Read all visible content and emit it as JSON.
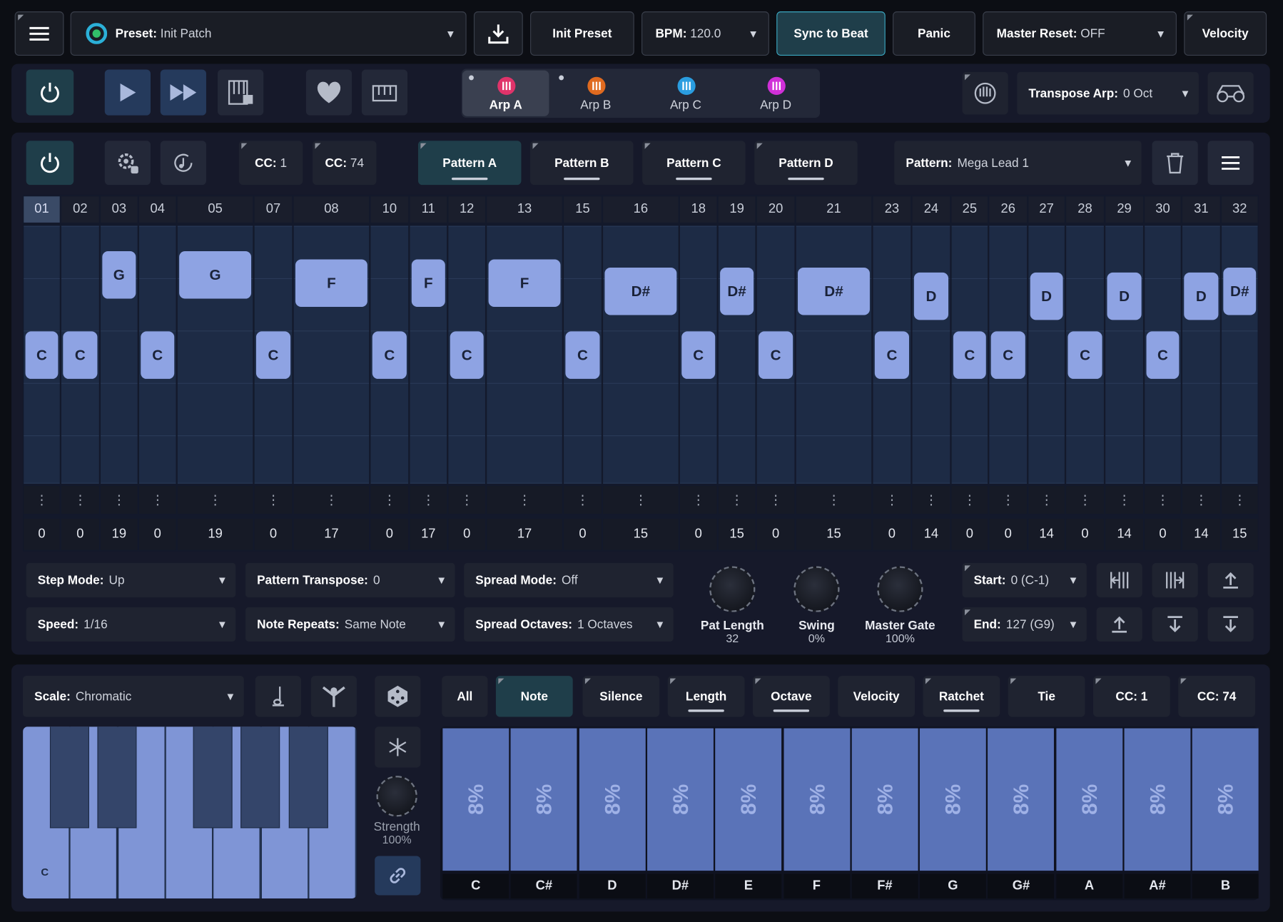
{
  "toolbar": {
    "preset_label": "Preset:",
    "preset_value": "Init Patch",
    "init_preset": "Init Preset",
    "bpm_label": "BPM:",
    "bpm_value": "120.0",
    "sync_to_beat": "Sync to Beat",
    "panic": "Panic",
    "master_reset_label": "Master Reset:",
    "master_reset_value": "OFF",
    "velocity": "Velocity"
  },
  "transport": {
    "arps": [
      {
        "label": "Arp A",
        "color": "#e0336a",
        "active": true
      },
      {
        "label": "Arp B",
        "color": "#e06a1f",
        "active": false
      },
      {
        "label": "Arp C",
        "color": "#2a9de0",
        "active": false
      },
      {
        "label": "Arp D",
        "color": "#d030d8",
        "active": false
      }
    ],
    "transpose_label": "Transpose Arp:",
    "transpose_value": "0 Oct"
  },
  "pattern_bar": {
    "cc1_label": "CC:",
    "cc1_value": "1",
    "cc2_label": "CC:",
    "cc2_value": "74",
    "patterns": [
      "Pattern A",
      "Pattern B",
      "Pattern C",
      "Pattern D"
    ],
    "pattern_label": "Pattern:",
    "pattern_value": "Mega Lead 1"
  },
  "steps": {
    "numbers": [
      "01",
      "02",
      "03",
      "04",
      "05",
      "07",
      "08",
      "10",
      "11",
      "12",
      "13",
      "15",
      "16",
      "18",
      "19",
      "20",
      "21",
      "23",
      "24",
      "25",
      "26",
      "27",
      "28",
      "29",
      "30",
      "31",
      "32"
    ],
    "notes": [
      "C",
      "C",
      "G",
      "C",
      "G",
      "C",
      "F",
      "C",
      "F",
      "C",
      "F",
      "C",
      "D#",
      "C",
      "D#",
      "C",
      "D#",
      "C",
      "D",
      "C",
      "C",
      "D",
      "C",
      "D",
      "C",
      "D",
      "D#"
    ],
    "values": [
      "0",
      "0",
      "19",
      "0",
      "19",
      "0",
      "17",
      "0",
      "17",
      "0",
      "17",
      "0",
      "15",
      "0",
      "15",
      "0",
      "15",
      "0",
      "14",
      "0",
      "0",
      "14",
      "0",
      "14",
      "0",
      "14",
      "15"
    ],
    "dots": "⋮"
  },
  "controls": {
    "step_mode_label": "Step Mode:",
    "step_mode_value": "Up",
    "pattern_transpose_label": "Pattern Transpose:",
    "pattern_transpose_value": "0",
    "spread_mode_label": "Spread Mode:",
    "spread_mode_value": "Off",
    "speed_label": "Speed:",
    "speed_value": "1/16",
    "note_repeats_label": "Note Repeats:",
    "note_repeats_value": "Same Note",
    "spread_octaves_label": "Spread Octaves:",
    "spread_octaves_value": "1 Octaves",
    "knobs": [
      {
        "label": "Pat Length",
        "value": "32"
      },
      {
        "label": "Swing",
        "value": "0%"
      },
      {
        "label": "Master Gate",
        "value": "100%"
      }
    ],
    "start_label": "Start:",
    "start_value": "0 (C-1)",
    "end_label": "End:",
    "end_value": "127 (G9)"
  },
  "bottom": {
    "scale_label": "Scale:",
    "scale_value": "Chromatic",
    "strength_label": "Strength",
    "strength_value": "100%",
    "keyboard_c_label": "C",
    "tabs": [
      "All",
      "Note",
      "Silence",
      "Length",
      "Octave",
      "Velocity",
      "Ratchet",
      "Tie",
      "CC: 1",
      "CC: 74"
    ],
    "note_percent": "8%",
    "note_names": [
      "C",
      "C#",
      "D",
      "D#",
      "E",
      "F",
      "F#",
      "G",
      "G#",
      "A",
      "A#",
      "B"
    ]
  }
}
